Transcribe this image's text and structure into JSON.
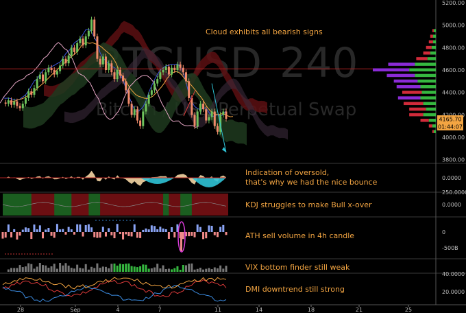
{
  "chart_data": {
    "type": "candlestick",
    "watermark": {
      "symbol": "BTCUSD",
      "interval": "240",
      "description": "Bitcoin / USD Perpetual Swap"
    },
    "x_ticks": [
      "28",
      "Sep",
      "4",
      "7",
      "11",
      "14",
      "18",
      "21",
      "25"
    ],
    "price_axis": {
      "ticks": [
        "5200.00",
        "5000.00",
        "4800.00",
        "4600.00",
        "4400.00",
        "4200.00",
        "4000.00",
        "3800.00"
      ],
      "range": [
        3780,
        5200
      ],
      "last_price_label": "4165.70",
      "countdown_label": "01:44:07",
      "horizontal_line_price": 4610
    },
    "price_path": [
      4310,
      4300,
      4330,
      4290,
      4320,
      4280,
      4260,
      4300,
      4350,
      4410,
      4380,
      4440,
      4520,
      4560,
      4500,
      4580,
      4620,
      4600,
      4560,
      4590,
      4640,
      4700,
      4660,
      4730,
      4800,
      4760,
      4840,
      4880,
      4820,
      4900,
      4950,
      5050,
      4900,
      4700,
      4650,
      4720,
      4600,
      4660,
      4580,
      4520,
      4600,
      4550,
      4500,
      4420,
      4300,
      4200,
      4250,
      4150,
      4100,
      4230,
      4300,
      4380,
      4420,
      4480,
      4520,
      4580,
      4600,
      4630,
      4560,
      4620,
      4600,
      4650,
      4620,
      4580,
      4500,
      4350,
      4200,
      4100,
      4230,
      4300,
      4250,
      4150,
      4180,
      4230,
      4100,
      4050,
      4200,
      4230,
      4165.7
    ],
    "volume_profile": [
      {
        "price": 4950,
        "buy": 3,
        "sell": 2
      },
      {
        "price": 4900,
        "buy": 4,
        "sell": 4
      },
      {
        "price": 4850,
        "buy": 4,
        "sell": 6
      },
      {
        "price": 4800,
        "buy": 6,
        "sell": 8
      },
      {
        "price": 4750,
        "buy": 8,
        "sell": 10
      },
      {
        "price": 4700,
        "buy": 12,
        "sell": 16
      },
      {
        "price": 4650,
        "buy": 30,
        "sell": 38
      },
      {
        "price": 4600,
        "buy": 38,
        "sell": 52
      },
      {
        "price": 4550,
        "buy": 30,
        "sell": 40
      },
      {
        "price": 4500,
        "buy": 26,
        "sell": 34
      },
      {
        "price": 4450,
        "buy": 22,
        "sell": 34
      },
      {
        "price": 4400,
        "buy": 20,
        "sell": 28
      },
      {
        "price": 4350,
        "buy": 22,
        "sell": 32
      },
      {
        "price": 4300,
        "buy": 18,
        "sell": 28
      },
      {
        "price": 4250,
        "buy": 14,
        "sell": 24
      },
      {
        "price": 4200,
        "buy": 18,
        "sell": 20
      },
      {
        "price": 4150,
        "buy": 10,
        "sell": 12
      },
      {
        "price": 4100,
        "buy": 5,
        "sell": 5
      },
      {
        "price": 4050,
        "buy": 3,
        "sell": 2
      }
    ],
    "panels": [
      {
        "name": "oscillator",
        "ticks": [
          "0.0000"
        ]
      },
      {
        "name": "kdj",
        "ticks": [
          "250.0000",
          "0.0000"
        ]
      },
      {
        "name": "volume",
        "ticks": [
          "0",
          "-500B"
        ]
      },
      {
        "name": "vix",
        "ticks": []
      },
      {
        "name": "dmi",
        "ticks": [
          "40.0000",
          "20.0000"
        ]
      }
    ],
    "annotations": [
      "Cloud exhibits all bearish signs",
      "Indication of oversold, that's why we had the nice bounce",
      "KDJ struggles to make Bull x-over",
      "ATH sell volume in 4h candle",
      "VIX bottom finder still weak",
      "DMI downtrend still strong"
    ],
    "colors": {
      "background": "#000000",
      "bull": "#6fc35c",
      "bear": "#f08a6a",
      "text_annotation": "#f3a542",
      "annotation_white": "#e6e6e6",
      "price_line": "#b22222",
      "cyan": "#2fc3d6",
      "magenta": "#d93bd9",
      "profile_purple": "#8a2bd6",
      "profile_red": "#d12b3a",
      "profile_green": "#36b840",
      "last_price_bg": "#f3a542"
    }
  }
}
